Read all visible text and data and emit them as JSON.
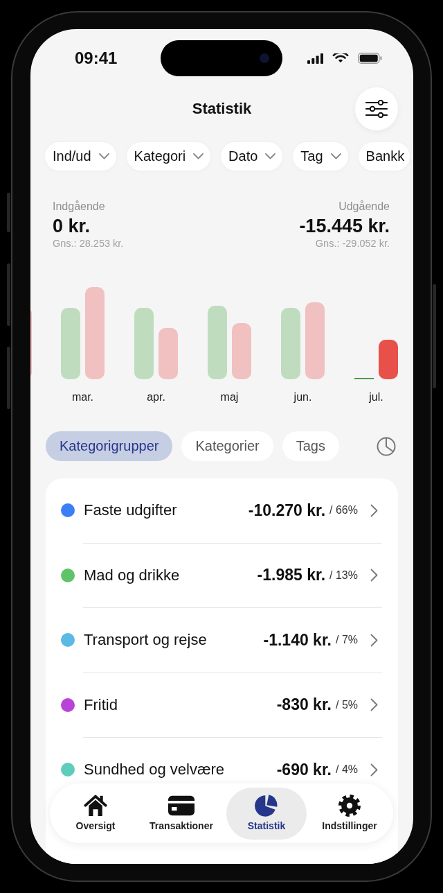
{
  "status_bar": {
    "time": "09:41"
  },
  "header": {
    "title": "Statistik"
  },
  "filters": [
    {
      "label": "Ind/ud",
      "dropdown": true
    },
    {
      "label": "Kategori",
      "dropdown": true
    },
    {
      "label": "Dato",
      "dropdown": true
    },
    {
      "label": "Tag",
      "dropdown": true
    },
    {
      "label": "Bankk",
      "dropdown": false
    }
  ],
  "summary": {
    "incoming": {
      "label": "Indgående",
      "amount": "0 kr.",
      "average": "Gns.: 28.253 kr."
    },
    "outgoing": {
      "label": "Udgående",
      "amount": "-15.445 kr.",
      "average": "Gns.: -29.052 kr."
    }
  },
  "chart": {
    "months": [
      {
        "label": "mar.",
        "selected": false
      },
      {
        "label": "apr.",
        "selected": false
      },
      {
        "label": "maj",
        "selected": false
      },
      {
        "label": "jun.",
        "selected": false
      },
      {
        "label": "jul.",
        "selected": true
      }
    ]
  },
  "segments": [
    {
      "label": "Kategorigrupper",
      "selected": true
    },
    {
      "label": "Kategorier",
      "selected": false
    },
    {
      "label": "Tags",
      "selected": false
    }
  ],
  "categories": [
    {
      "name": "Faste udgifter",
      "amount": "-10.270 kr.",
      "share": "/ 66%",
      "color": "#3a7ff5"
    },
    {
      "name": "Mad og drikke",
      "amount": "-1.985 kr.",
      "share": "/ 13%",
      "color": "#5fc36a"
    },
    {
      "name": "Transport og rejse",
      "amount": "-1.140 kr.",
      "share": "/ 7%",
      "color": "#5ab9e5"
    },
    {
      "name": "Fritid",
      "amount": "-830 kr.",
      "share": "/ 5%",
      "color": "#b943d8"
    },
    {
      "name": "Sundhed og velvære",
      "amount": "-690 kr.",
      "share": "/ 4%",
      "color": "#5fcdbb"
    }
  ],
  "tab_bar": [
    {
      "label": "Oversigt",
      "kind": "home",
      "selected": false
    },
    {
      "label": "Transaktioner",
      "kind": "card",
      "selected": false
    },
    {
      "label": "Statistik",
      "kind": "pie",
      "selected": true
    },
    {
      "label": "Indstillinger",
      "kind": "gear",
      "selected": false
    }
  ]
}
